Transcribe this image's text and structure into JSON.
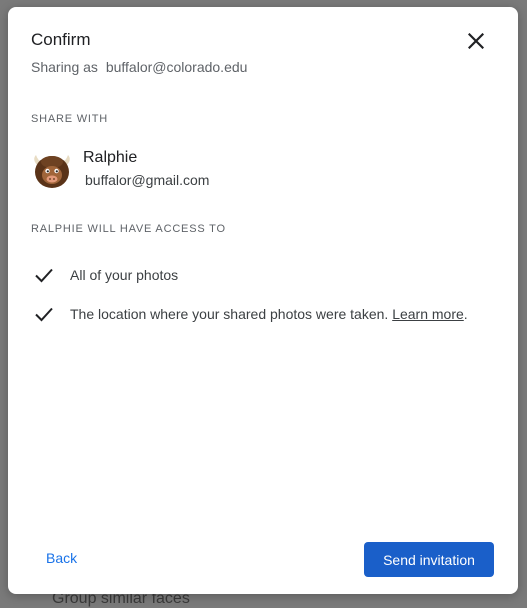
{
  "background": {
    "peek_text": "Group similar faces"
  },
  "dialog": {
    "title": "Confirm",
    "sharing_as_label": "Sharing as",
    "sharing_as_email": "buffalor@colorado.edu",
    "share_with_label": "SHARE WITH",
    "contact": {
      "name": "Ralphie",
      "email": "buffalor@gmail.com",
      "avatar_icon": "buffalo-avatar-icon"
    },
    "access_label": "RALPHIE WILL HAVE ACCESS TO",
    "access_items": [
      {
        "text": "All of your photos"
      },
      {
        "text": "The location where your shared photos were taken.",
        "link": "Learn more",
        "suffix": "."
      }
    ],
    "back_label": "Back",
    "send_label": "Send invitation"
  },
  "colors": {
    "accent": "#1a73e8",
    "primary_button": "#1a5fc9",
    "overlay": "#7a7a7a"
  }
}
